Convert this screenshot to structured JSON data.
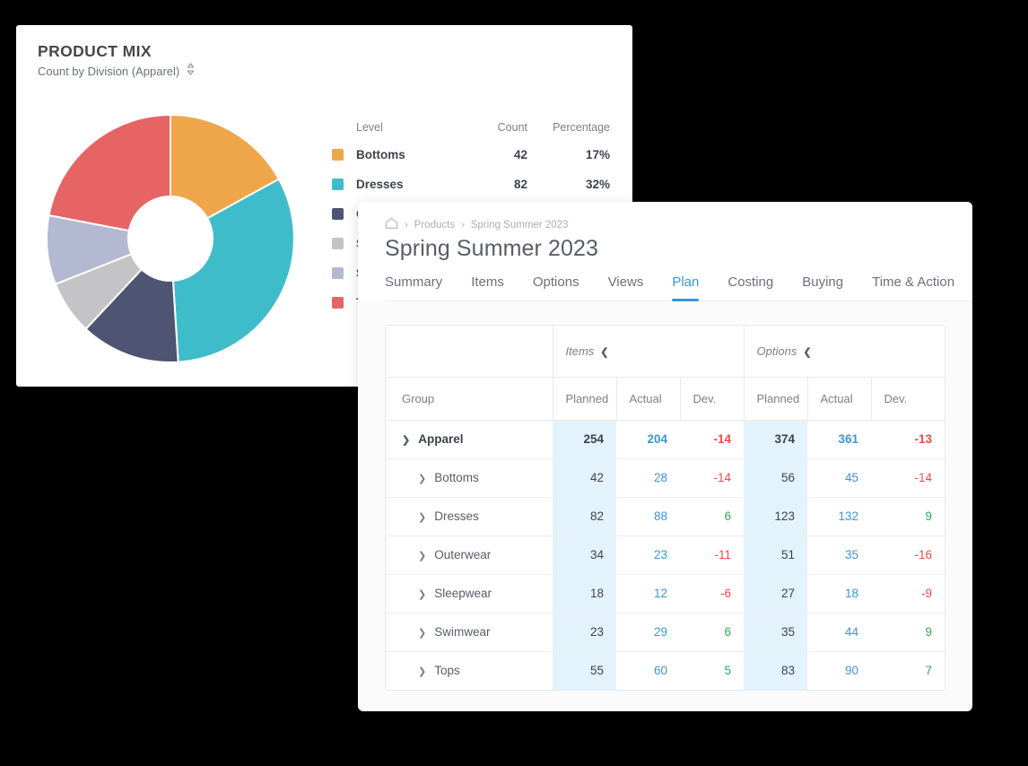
{
  "chart_card": {
    "title": "PRODUCT MIX",
    "subtitle": "Count by Division (Apparel)",
    "sort_icon": "up-down-chevron-icon",
    "legend_headers": {
      "level": "Level",
      "count": "Count",
      "percentage": "Percentage"
    }
  },
  "chart_data": {
    "type": "pie",
    "title": "PRODUCT MIX",
    "subtitle": "Count by Division (Apparel)",
    "donut": true,
    "legend_position": "right",
    "categories": [
      "Bottoms",
      "Dresses",
      "Outerwear",
      "Sleepwear",
      "Swimwear",
      "Tops"
    ],
    "values": [
      42,
      82,
      34,
      18,
      23,
      55
    ],
    "percentages": [
      "17%",
      "32%",
      "13%",
      "7%",
      "9%",
      "22%"
    ],
    "colors": [
      "#efa64b",
      "#3fbcc9",
      "#4e5472",
      "#c4c4c6",
      "#b4b9d2",
      "#e66464"
    ],
    "total": 254,
    "ylabel": "",
    "xlabel": ""
  },
  "detail_card": {
    "breadcrumb": {
      "home_icon": "home-icon",
      "separator": "›",
      "items": [
        "Products",
        "Spring Summer 2023"
      ]
    },
    "page_title": "Spring Summer 2023",
    "tabs": [
      {
        "label": "Summary",
        "active": false
      },
      {
        "label": "Items",
        "active": false
      },
      {
        "label": "Options",
        "active": false
      },
      {
        "label": "Views",
        "active": false
      },
      {
        "label": "Plan",
        "active": true
      },
      {
        "label": "Costing",
        "active": false
      },
      {
        "label": "Buying",
        "active": false
      },
      {
        "label": "Time & Action",
        "active": false
      }
    ],
    "accent_color": "#3e95d4"
  },
  "table": {
    "group_headers": [
      {
        "label": "Items",
        "collapse_icon": "chevron-left-icon"
      },
      {
        "label": "Options",
        "collapse_icon": "chevron-left-icon"
      }
    ],
    "columns": [
      "Group",
      "Planned",
      "Actual",
      "Dev.",
      "Planned",
      "Actual",
      "Dev."
    ],
    "rows": [
      {
        "label": "Apparel",
        "level": 0,
        "expanded": true,
        "chevron": "chevron-down-icon",
        "items_planned": "254",
        "items_actual": "204",
        "items_dev": "-14",
        "items_dev_sign": "neg",
        "options_planned": "374",
        "options_actual": "361",
        "options_dev": "-13",
        "options_dev_sign": "neg"
      },
      {
        "label": "Bottoms",
        "level": 1,
        "expanded": false,
        "chevron": "chevron-right-icon",
        "items_planned": "42",
        "items_actual": "28",
        "items_dev": "-14",
        "items_dev_sign": "neg",
        "options_planned": "56",
        "options_actual": "45",
        "options_dev": "-14",
        "options_dev_sign": "neg"
      },
      {
        "label": "Dresses",
        "level": 1,
        "expanded": false,
        "chevron": "chevron-right-icon",
        "items_planned": "82",
        "items_actual": "88",
        "items_dev": "6",
        "items_dev_sign": "pos",
        "options_planned": "123",
        "options_actual": "132",
        "options_dev": "9",
        "options_dev_sign": "pos"
      },
      {
        "label": "Outerwear",
        "level": 1,
        "expanded": false,
        "chevron": "chevron-right-icon",
        "items_planned": "34",
        "items_actual": "23",
        "items_dev": "-11",
        "items_dev_sign": "neg",
        "options_planned": "51",
        "options_actual": "35",
        "options_dev": "-16",
        "options_dev_sign": "neg"
      },
      {
        "label": "Sleepwear",
        "level": 1,
        "expanded": false,
        "chevron": "chevron-right-icon",
        "items_planned": "18",
        "items_actual": "12",
        "items_dev": "-6",
        "items_dev_sign": "neg",
        "options_planned": "27",
        "options_actual": "18",
        "options_dev": "-9",
        "options_dev_sign": "neg"
      },
      {
        "label": "Swimwear",
        "level": 1,
        "expanded": false,
        "chevron": "chevron-right-icon",
        "items_planned": "23",
        "items_actual": "29",
        "items_dev": "6",
        "items_dev_sign": "pos",
        "options_planned": "35",
        "options_actual": "44",
        "options_dev": "9",
        "options_dev_sign": "pos"
      },
      {
        "label": "Tops",
        "level": 1,
        "expanded": false,
        "chevron": "chevron-right-icon",
        "items_planned": "55",
        "items_actual": "60",
        "items_dev": "5",
        "items_dev_sign": "pos",
        "options_planned": "83",
        "options_actual": "90",
        "options_dev": "7",
        "options_dev_sign": "pos"
      }
    ],
    "planned_highlight_color": "#e3f3fc",
    "actual_color": "#3e95d4",
    "negative_color": "#ea4b4b",
    "positive_color": "#33a852"
  }
}
